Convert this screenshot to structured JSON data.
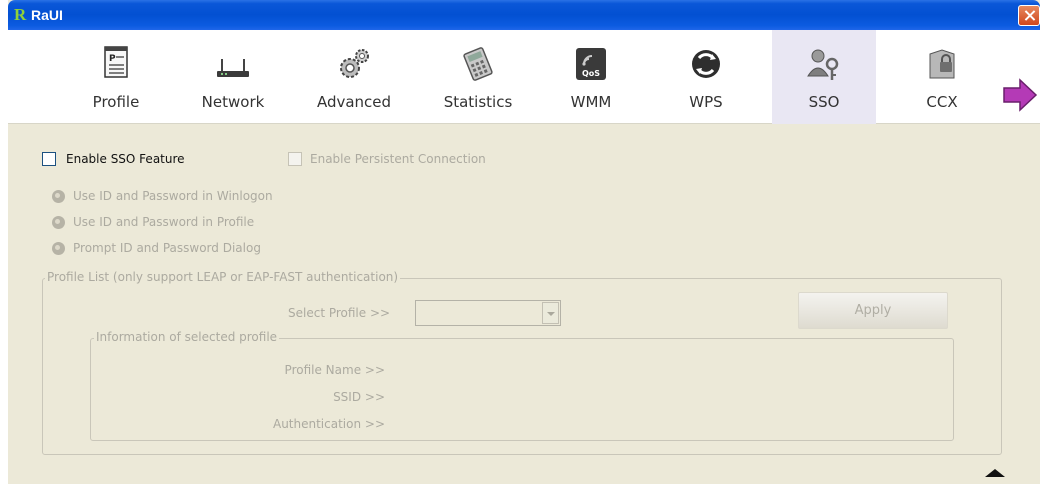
{
  "window": {
    "title": "RaUI",
    "logo_letter": "R"
  },
  "toolbar": {
    "items": [
      {
        "label": "Profile",
        "icon": "profile-icon"
      },
      {
        "label": "Network",
        "icon": "network-icon"
      },
      {
        "label": "Advanced",
        "icon": "advanced-icon"
      },
      {
        "label": "Statistics",
        "icon": "statistics-icon"
      },
      {
        "label": "WMM",
        "icon": "wmm-icon",
        "badge": "QoS"
      },
      {
        "label": "WPS",
        "icon": "wps-icon"
      },
      {
        "label": "SSO",
        "icon": "sso-icon",
        "selected": true
      },
      {
        "label": "CCX",
        "icon": "ccx-icon"
      }
    ],
    "next_icon": "arrow-right-icon"
  },
  "sso": {
    "enable_sso_label": "Enable SSO Feature",
    "enable_sso_checked": false,
    "persistent_label": "Enable Persistent Connection",
    "persistent_checked": false,
    "radio_options": [
      "Use ID and Password in Winlogon",
      "Use ID and Password in Profile",
      "Prompt ID and Password Dialog"
    ],
    "profile_list": {
      "legend": "Profile List (only support LEAP or EAP-FAST authentication)",
      "select_label": "Select Profile >>",
      "select_value": "",
      "apply_label": "Apply",
      "info": {
        "legend": "Information of selected profile",
        "profile_name_label": "Profile Name >>",
        "ssid_label": "SSID >>",
        "authentication_label": "Authentication >>"
      }
    }
  },
  "colors": {
    "titlebar": "#0350d2",
    "window_bg": "#ece9d8",
    "selected_tab": "#e9e7f3",
    "accent_arrow": "#b43ab6"
  }
}
